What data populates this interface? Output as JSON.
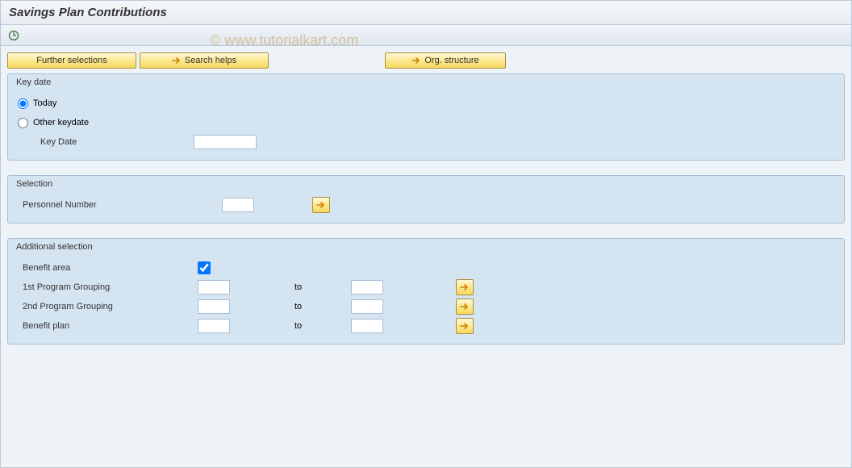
{
  "title": "Savings Plan Contributions",
  "watermark": "© www.tutorialkart.com",
  "buttons": {
    "further_selections": "Further selections",
    "search_helps": "Search helps",
    "org_structure": "Org. structure"
  },
  "groups": {
    "key_date": {
      "title": "Key date",
      "today_label": "Today",
      "other_keydate_label": "Other keydate",
      "key_date_label": "Key Date",
      "key_date_value": ""
    },
    "selection": {
      "title": "Selection",
      "personnel_number_label": "Personnel Number",
      "personnel_number_value": ""
    },
    "additional": {
      "title": "Additional selection",
      "benefit_area_label": "Benefit area",
      "benefit_area_checked": true,
      "to_label": "to",
      "rows": [
        {
          "label": "1st Program Grouping",
          "from": "",
          "to": ""
        },
        {
          "label": "2nd Program Grouping",
          "from": "",
          "to": ""
        },
        {
          "label": "Benefit plan",
          "from": "",
          "to": ""
        }
      ]
    }
  }
}
